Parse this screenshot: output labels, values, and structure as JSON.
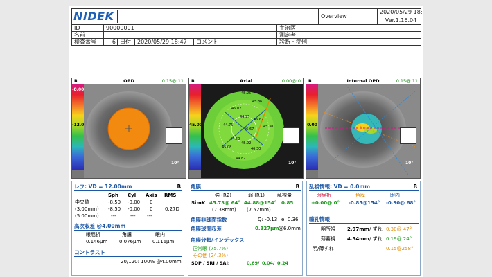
{
  "header": {
    "logo": "NIDEK",
    "overview": "Overview",
    "datetime": "2020/05/29 18:48",
    "version": "Ver.1.16.04",
    "id_label": "ID",
    "id_value": "90000001",
    "name_label": "名前",
    "doctor_label": "主治医",
    "operator_label": "測定者",
    "exam_label": "検査番号",
    "exam_value": "6",
    "date_label": "日付",
    "date_value": "2020/05/29 18:47",
    "comment_label": "コメント",
    "diagnosis_label": "診断・症例"
  },
  "maps": [
    {
      "eye": "R",
      "title": "OPD",
      "value": "0.15@ 11",
      "scale_top": "-8.00",
      "scale_mid": "-12.00",
      "degree": "10°"
    },
    {
      "eye": "R",
      "title": "Axial",
      "value": "0.00@ 0",
      "scale_mid": "45.00",
      "degree": "10°",
      "points": [
        "45.25",
        "45.86",
        "46.02",
        "44.95",
        "46.67",
        "45.38",
        "44.76",
        "46.67",
        "44.50",
        "45.92",
        "45.08",
        "46.30",
        "44.82"
      ]
    },
    {
      "eye": "R",
      "title": "Internal OPD",
      "value": "0.15@ 11",
      "scale_mid": "0.00",
      "degree": "10°"
    }
  ],
  "refraction": {
    "title": "レフ: VD = 12.00mm",
    "eye": "R",
    "cols": [
      "Sph",
      "Cyl",
      "Axis",
      "RMS"
    ],
    "rows": [
      {
        "label": "中央値",
        "sph": "-8.50",
        "cyl": "-0.00",
        "axis": "0",
        "rms": ""
      },
      {
        "label": "(3.00mm)",
        "sph": "-8.50",
        "cyl": "-0.00",
        "axis": "0",
        "rms": "0.27D"
      },
      {
        "label": "(5.00mm)",
        "sph": "---",
        "cyl": "---",
        "axis": "---",
        "rms": ""
      }
    ],
    "hoa_title": "高次収差 @4.00mm",
    "hoa_cols": [
      "眼屈折",
      "角膜",
      "眼内"
    ],
    "hoa_vals": [
      "0.146μm",
      "0.076μm",
      "0.116μm"
    ],
    "contrast_title": "コントラスト",
    "contrast_value": "20/120: 100% @4.00mm"
  },
  "cornea": {
    "title": "角膜",
    "eye": "R",
    "col1": "強 (R2)",
    "col2": "弱 (R1)",
    "col3": "乱視量",
    "simk_label": "SimK",
    "simk_strong": "45.73@ 64°",
    "simk_weak": "44.88@154°",
    "simk_astig": "0.85",
    "simk_strong_mm": "(7.38mm)",
    "simk_weak_mm": "(7.52mm)",
    "asph_title": "角膜非球面指数",
    "asph_q": "Q: -0.13",
    "asph_e": "e: 0.36",
    "ab_title": "角膜球面収差",
    "ab_value": "0.327μm",
    "ab_at": "@6.0mm",
    "class_title": "角膜分類/インデックス",
    "normal": "正常眼 (75.7%)",
    "other": "その他 (24.3%)",
    "sdp_label": "SDP / SRI / SAI:",
    "sdp1": "0.69",
    "sdp2": "0.04",
    "sdp3": "0.24"
  },
  "astig": {
    "title": "乱視情報: VD = 0.0mm",
    "eye": "R",
    "cols": [
      "眼屈折",
      "角膜",
      "眼内"
    ],
    "vals": [
      "+0.00@ 0°",
      "-0.85@154°",
      "-0.90@ 68°"
    ],
    "pupil_title": "瞳孔情報",
    "photopic_label": "明所視",
    "photopic_size": "2.97mm",
    "photopic_shift_label": "/ ずれ",
    "photopic_shift": "0.30@ 47°",
    "mesopic_label": "薄暮視",
    "mesopic_size": "4.34mm",
    "mesopic_shift_label": "/ ずれ",
    "mesopic_shift": "0.19@ 24°",
    "diff_label": "明/薄ずれ",
    "diff_value": "0.15@258°"
  },
  "colors": {
    "accent": "#1d58a6",
    "green": "#1a9a1a",
    "orange": "#e08a00",
    "red": "#d0103a"
  }
}
